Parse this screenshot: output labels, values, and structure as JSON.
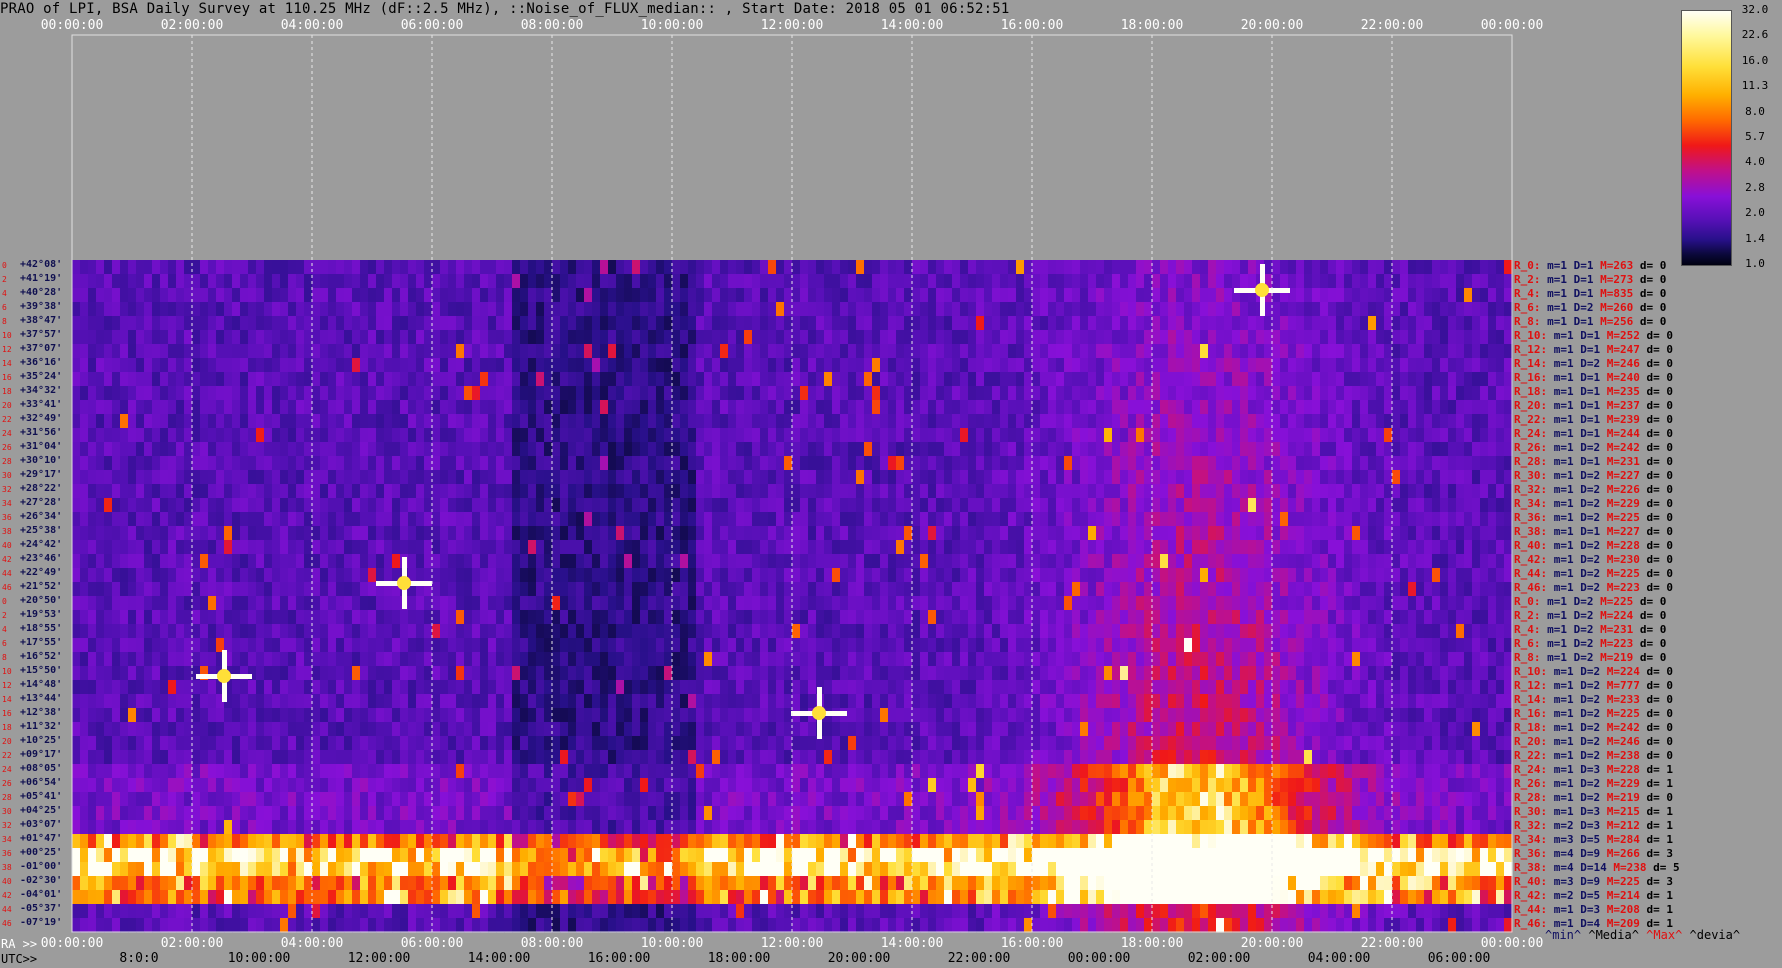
{
  "title": "PRAO of LPI, BSA Daily Survey at 110.25 MHz (dF::2.5 MHz), ::Noise_of_FLUX_median:: , Start Date: 2018 05 01 06:52:51",
  "axis_prefix": {
    "ra": "RA >>",
    "utc": "UTC>>"
  },
  "colors": {
    "background": "#9c9c9c",
    "low": "#000010",
    "mid": "#8810d8",
    "high": "#ff6a00",
    "max": "#fffff6",
    "max_key": "#e01010",
    "min_key": "#101060"
  },
  "legend_keys": {
    "min": "^min^",
    "media": "^Media^",
    "max": "^Max^",
    "devia": "^devia^"
  },
  "chart_data": {
    "type": "heatmap",
    "title": "PRAO of LPI, BSA Daily Survey at 110.25 MHz (dF::2.5 MHz), ::Noise_of_FLUX_median:: , Start Date: 2018 05 01 06:52:51",
    "x_top_ticks": [
      "00:00:00",
      "02:00:00",
      "04:00:00",
      "06:00:00",
      "08:00:00",
      "10:00:00",
      "12:00:00",
      "14:00:00",
      "16:00:00",
      "18:00:00",
      "20:00:00",
      "22:00:00",
      "00:00:00"
    ],
    "ra_ticks": [
      "00:00:00",
      "02:00:00",
      "04:00:00",
      "06:00:00",
      "08:00:00",
      "10:00:00",
      "12:00:00",
      "14:00:00",
      "16:00:00",
      "18:00:00",
      "20:00:00",
      "22:00:00",
      "00:00:00"
    ],
    "utc_ticks": [
      "8:0:0",
      "10:00:00",
      "12:00:00",
      "14:00:00",
      "16:00:00",
      "18:00:00",
      "20:00:00",
      "22:00:00",
      "00:00:00",
      "02:00:00",
      "04:00:00",
      "06:00:00"
    ],
    "colorbar": {
      "scale": "log",
      "ticks": [
        "32.0",
        "22.6",
        "16.0",
        "11.3",
        "8.0",
        "5.7",
        "4.0",
        "2.8",
        "2.0",
        "1.4",
        "1.0"
      ]
    },
    "declinations": [
      "+42°08'",
      "+41°19'",
      "+40°28'",
      "+39°38'",
      "+38°47'",
      "+37°57'",
      "+37°07'",
      "+36°16'",
      "+35°24'",
      "+34°32'",
      "+33°41'",
      "+32°49'",
      "+31°56'",
      "+31°04'",
      "+30°10'",
      "+29°17'",
      "+28°22'",
      "+27°28'",
      "+26°34'",
      "+25°38'",
      "+24°42'",
      "+23°46'",
      "+22°49'",
      "+21°52'",
      "+20°50'",
      "+19°53'",
      "+18°55'",
      "+17°55'",
      "+16°52'",
      "+15°50'",
      "+14°48'",
      "+13°44'",
      "+12°38'",
      "+11°32'",
      "+10°25'",
      "+09°17'",
      "+08°05'",
      "+06°54'",
      "+05°41'",
      "+04°25'",
      "+03°07'",
      "+01°47'",
      "+00°25'",
      "-01°00'",
      "-02°30'",
      "-04°01'",
      "-05°37'",
      "-07°19'"
    ],
    "row_index_labels": [
      "0",
      "2",
      "4",
      "6",
      "8",
      "10",
      "12",
      "14",
      "16",
      "18",
      "20",
      "22",
      "24",
      "26",
      "28",
      "30",
      "32",
      "34",
      "36",
      "38",
      "40",
      "42",
      "44",
      "46",
      "0",
      "2",
      "4",
      "6",
      "8",
      "10",
      "12",
      "14",
      "16",
      "18",
      "20",
      "22",
      "24",
      "26",
      "28",
      "30",
      "32",
      "34",
      "36",
      "38",
      "40",
      "42",
      "44",
      "46"
    ],
    "row_stats": [
      {
        "r": "R_0:",
        "m": "m=1",
        "d": "D=1",
        "mx": "M=263",
        "dv": "d= 0"
      },
      {
        "r": "R_2:",
        "m": "m=1",
        "d": "D=1",
        "mx": "M=273",
        "dv": "d= 0"
      },
      {
        "r": "R_4:",
        "m": "m=1",
        "d": "D=1",
        "mx": "M=835",
        "dv": "d= 0"
      },
      {
        "r": "R_6:",
        "m": "m=1",
        "d": "D=2",
        "mx": "M=260",
        "dv": "d= 0"
      },
      {
        "r": "R_8:",
        "m": "m=1",
        "d": "D=1",
        "mx": "M=256",
        "dv": "d= 0"
      },
      {
        "r": "R_10:",
        "m": "m=1",
        "d": "D=1",
        "mx": "M=252",
        "dv": "d= 0"
      },
      {
        "r": "R_12:",
        "m": "m=1",
        "d": "D=1",
        "mx": "M=247",
        "dv": "d= 0"
      },
      {
        "r": "R_14:",
        "m": "m=1",
        "d": "D=2",
        "mx": "M=246",
        "dv": "d= 0"
      },
      {
        "r": "R_16:",
        "m": "m=1",
        "d": "D=1",
        "mx": "M=240",
        "dv": "d= 0"
      },
      {
        "r": "R_18:",
        "m": "m=1",
        "d": "D=1",
        "mx": "M=235",
        "dv": "d= 0"
      },
      {
        "r": "R_20:",
        "m": "m=1",
        "d": "D=1",
        "mx": "M=237",
        "dv": "d= 0"
      },
      {
        "r": "R_22:",
        "m": "m=1",
        "d": "D=1",
        "mx": "M=239",
        "dv": "d= 0"
      },
      {
        "r": "R_24:",
        "m": "m=1",
        "d": "D=1",
        "mx": "M=244",
        "dv": "d= 0"
      },
      {
        "r": "R_26:",
        "m": "m=1",
        "d": "D=2",
        "mx": "M=242",
        "dv": "d= 0"
      },
      {
        "r": "R_28:",
        "m": "m=1",
        "d": "D=1",
        "mx": "M=231",
        "dv": "d= 0"
      },
      {
        "r": "R_30:",
        "m": "m=1",
        "d": "D=2",
        "mx": "M=227",
        "dv": "d= 0"
      },
      {
        "r": "R_32:",
        "m": "m=1",
        "d": "D=2",
        "mx": "M=226",
        "dv": "d= 0"
      },
      {
        "r": "R_34:",
        "m": "m=1",
        "d": "D=2",
        "mx": "M=229",
        "dv": "d= 0"
      },
      {
        "r": "R_36:",
        "m": "m=1",
        "d": "D=2",
        "mx": "M=225",
        "dv": "d= 0"
      },
      {
        "r": "R_38:",
        "m": "m=1",
        "d": "D=1",
        "mx": "M=227",
        "dv": "d= 0"
      },
      {
        "r": "R_40:",
        "m": "m=1",
        "d": "D=2",
        "mx": "M=228",
        "dv": "d= 0"
      },
      {
        "r": "R_42:",
        "m": "m=1",
        "d": "D=2",
        "mx": "M=230",
        "dv": "d= 0"
      },
      {
        "r": "R_44:",
        "m": "m=1",
        "d": "D=2",
        "mx": "M=225",
        "dv": "d= 0"
      },
      {
        "r": "R_46:",
        "m": "m=1",
        "d": "D=2",
        "mx": "M=223",
        "dv": "d= 0"
      },
      {
        "r": "R_0:",
        "m": "m=1",
        "d": "D=2",
        "mx": "M=225",
        "dv": "d= 0"
      },
      {
        "r": "R_2:",
        "m": "m=1",
        "d": "D=2",
        "mx": "M=224",
        "dv": "d= 0"
      },
      {
        "r": "R_4:",
        "m": "m=1",
        "d": "D=2",
        "mx": "M=231",
        "dv": "d= 0"
      },
      {
        "r": "R_6:",
        "m": "m=1",
        "d": "D=2",
        "mx": "M=223",
        "dv": "d= 0"
      },
      {
        "r": "R_8:",
        "m": "m=1",
        "d": "D=2",
        "mx": "M=219",
        "dv": "d= 0"
      },
      {
        "r": "R_10:",
        "m": "m=1",
        "d": "D=2",
        "mx": "M=224",
        "dv": "d= 0"
      },
      {
        "r": "R_12:",
        "m": "m=1",
        "d": "D=2",
        "mx": "M=777",
        "dv": "d= 0"
      },
      {
        "r": "R_14:",
        "m": "m=1",
        "d": "D=2",
        "mx": "M=233",
        "dv": "d= 0"
      },
      {
        "r": "R_16:",
        "m": "m=1",
        "d": "D=2",
        "mx": "M=225",
        "dv": "d= 0"
      },
      {
        "r": "R_18:",
        "m": "m=1",
        "d": "D=2",
        "mx": "M=242",
        "dv": "d= 0"
      },
      {
        "r": "R_20:",
        "m": "m=1",
        "d": "D=2",
        "mx": "M=246",
        "dv": "d= 0"
      },
      {
        "r": "R_22:",
        "m": "m=1",
        "d": "D=2",
        "mx": "M=238",
        "dv": "d= 0"
      },
      {
        "r": "R_24:",
        "m": "m=1",
        "d": "D=3",
        "mx": "M=228",
        "dv": "d= 1"
      },
      {
        "r": "R_26:",
        "m": "m=1",
        "d": "D=2",
        "mx": "M=229",
        "dv": "d= 1"
      },
      {
        "r": "R_28:",
        "m": "m=1",
        "d": "D=2",
        "mx": "M=219",
        "dv": "d= 0"
      },
      {
        "r": "R_30:",
        "m": "m=1",
        "d": "D=3",
        "mx": "M=215",
        "dv": "d= 1"
      },
      {
        "r": "R_32:",
        "m": "m=2",
        "d": "D=3",
        "mx": "M=212",
        "dv": "d= 1"
      },
      {
        "r": "R_34:",
        "m": "m=3",
        "d": "D=5",
        "mx": "M=284",
        "dv": "d= 1"
      },
      {
        "r": "R_36:",
        "m": "m=4",
        "d": "D=9",
        "mx": "M=266",
        "dv": "d= 3"
      },
      {
        "r": "R_38:",
        "m": "m=4",
        "d": "D=14",
        "mx": "M=238",
        "dv": "d= 5"
      },
      {
        "r": "R_40:",
        "m": "m=3",
        "d": "D=9",
        "mx": "M=225",
        "dv": "d= 3"
      },
      {
        "r": "R_42:",
        "m": "m=2",
        "d": "D=5",
        "mx": "M=214",
        "dv": "d= 1"
      },
      {
        "r": "R_44:",
        "m": "m=1",
        "d": "D=3",
        "mx": "M=208",
        "dv": "d= 1"
      },
      {
        "r": "R_46:",
        "m": "m=1",
        "d": "D=4",
        "mx": "M=209",
        "dv": "d= 1"
      }
    ]
  }
}
